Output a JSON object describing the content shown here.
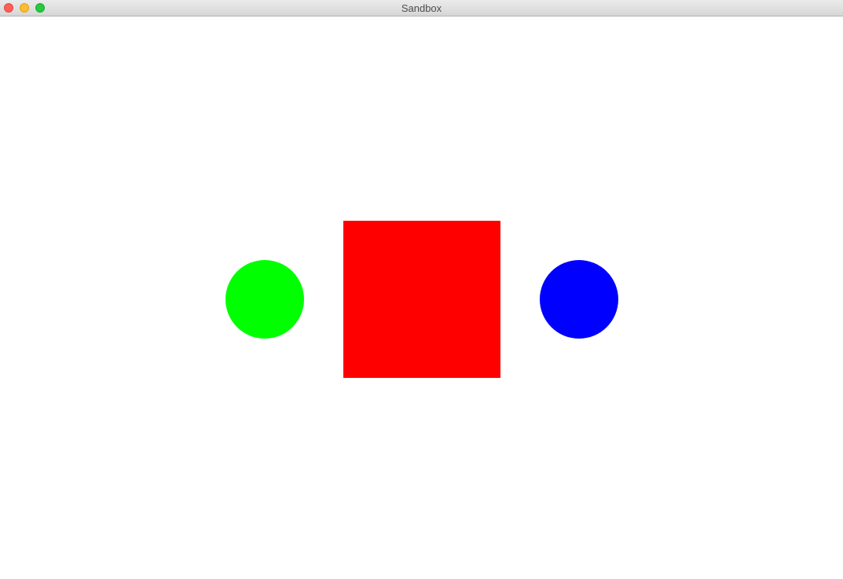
{
  "window": {
    "title": "Sandbox",
    "controls": {
      "close_color": "#ff5f57",
      "close_border": "#e2463f",
      "minimize_color": "#febc2e",
      "minimize_border": "#e1a116",
      "zoom_color": "#28c840",
      "zoom_border": "#14ae29"
    }
  },
  "canvas": {
    "background": "#ffffff",
    "shapes": [
      {
        "name": "green-circle",
        "kind": "circle",
        "color": "#00ff00"
      },
      {
        "name": "red-square",
        "kind": "square",
        "color": "#ff0000"
      },
      {
        "name": "blue-circle",
        "kind": "circle",
        "color": "#0000ff"
      }
    ]
  }
}
